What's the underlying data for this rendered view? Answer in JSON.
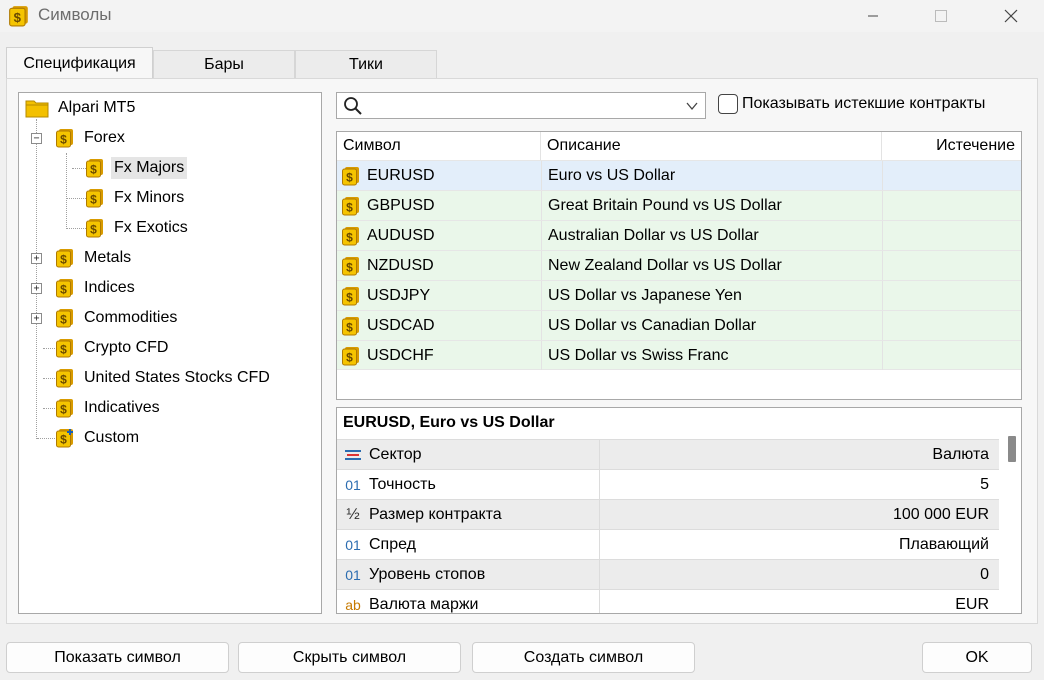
{
  "window": {
    "title": "Символы",
    "icon": "dollar-coin-icon",
    "controls": [
      "minimize-icon",
      "maximize-icon",
      "close-icon"
    ]
  },
  "tabs": [
    {
      "label": "Спецификация",
      "active": true
    },
    {
      "label": "Бары",
      "active": false
    },
    {
      "label": "Тики",
      "active": false
    }
  ],
  "tree": {
    "root": "Alpari MT5",
    "nodes": [
      {
        "label": "Forex",
        "expanded": true
      },
      {
        "label": "Fx Majors",
        "selected": true
      },
      {
        "label": "Fx Minors"
      },
      {
        "label": "Fx Exotics"
      },
      {
        "label": "Metals",
        "expandable": true
      },
      {
        "label": "Indices",
        "expandable": true
      },
      {
        "label": "Commodities",
        "expandable": true
      },
      {
        "label": "Crypto CFD"
      },
      {
        "label": "United States Stocks CFD"
      },
      {
        "label": "Indicatives"
      },
      {
        "label": "Custom"
      }
    ]
  },
  "search": {
    "placeholder": "",
    "value": ""
  },
  "expired_checkbox": {
    "label": "Показывать истекшие контракты",
    "checked": false
  },
  "symbols_table": {
    "columns": [
      "Символ",
      "Описание",
      "Истечение"
    ],
    "rows": [
      {
        "symbol": "EURUSD",
        "description": "Euro vs US Dollar",
        "expiry": ""
      },
      {
        "symbol": "GBPUSD",
        "description": "Great Britain Pound vs US Dollar",
        "expiry": ""
      },
      {
        "symbol": "AUDUSD",
        "description": "Australian Dollar vs US Dollar",
        "expiry": ""
      },
      {
        "symbol": "NZDUSD",
        "description": "New Zealand Dollar vs US Dollar",
        "expiry": ""
      },
      {
        "symbol": "USDJPY",
        "description": "US Dollar vs Japanese Yen",
        "expiry": ""
      },
      {
        "symbol": "USDCAD",
        "description": "US Dollar vs Canadian Dollar",
        "expiry": ""
      },
      {
        "symbol": "USDCHF",
        "description": "US Dollar vs Swiss Franc",
        "expiry": ""
      }
    ]
  },
  "spec": {
    "title": "EURUSD, Euro vs US Dollar",
    "properties": [
      {
        "icon": "sector-icon",
        "name": "Сектор",
        "value": "Валюта"
      },
      {
        "icon": "digits-icon",
        "name": "Точность",
        "value": "5"
      },
      {
        "icon": "fraction-icon",
        "name": "Размер контракта",
        "value": "100 000 EUR"
      },
      {
        "icon": "digits-icon",
        "name": "Спред",
        "value": "Плавающий"
      },
      {
        "icon": "digits-icon",
        "name": "Уровень стопов",
        "value": "0"
      },
      {
        "icon": "text-icon",
        "name": "Валюта маржи",
        "value": "EUR"
      }
    ]
  },
  "buttons": {
    "show": "Показать символ",
    "hide": "Скрыть символ",
    "create": "Создать символ",
    "ok": "OK"
  },
  "colors": {
    "selected_row": "#e3eefa",
    "row_green": "#eaf7ea",
    "coin": "#f3c000"
  }
}
